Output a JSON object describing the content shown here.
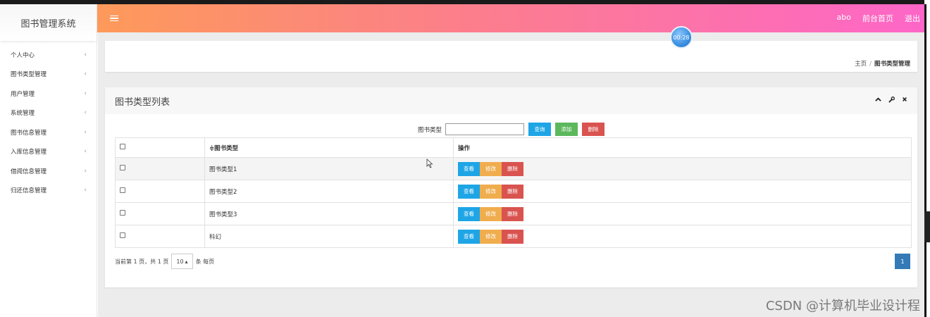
{
  "app": {
    "title": "图书管理系统"
  },
  "sidebar": {
    "items": [
      {
        "label": "个人中心"
      },
      {
        "label": "图书类型管理"
      },
      {
        "label": "用户管理"
      },
      {
        "label": "系统管理"
      },
      {
        "label": "图书信息管理"
      },
      {
        "label": "入库信息管理"
      },
      {
        "label": "借阅信息管理"
      },
      {
        "label": "归还信息管理"
      }
    ],
    "chevron": "‹"
  },
  "header": {
    "user": "abo",
    "front_home": "前台首页",
    "logout": "退出",
    "timer": "00:28"
  },
  "breadcrumb": {
    "home": "主页",
    "separator": "/",
    "current": "图书类型管理"
  },
  "panel": {
    "title": "图书类型列表",
    "tools": {
      "collapse": "⌃",
      "settings": "wrench-icon",
      "close": "✕"
    }
  },
  "search": {
    "label": "图书类型",
    "value": "",
    "query_btn": "查询",
    "add_btn": "添加",
    "delete_btn": "删除"
  },
  "table": {
    "headers": [
      "",
      "≑图书类型",
      "操作"
    ],
    "rows": [
      {
        "type": "图书类型1"
      },
      {
        "type": "图书类型2"
      },
      {
        "type": "图书类型3"
      },
      {
        "type": "科幻"
      }
    ],
    "actions": {
      "view": "查看",
      "edit": "修改",
      "delete": "删除"
    }
  },
  "pagination": {
    "summary": "当前第 1 页，共 1 页",
    "page_size": "10",
    "per_page": "条 每页",
    "current_page": "1"
  },
  "watermark": "CSDN @计算机毕业设计程",
  "colors": {
    "header_gradient_start": "#fd9a5a",
    "header_gradient_end": "#fd66c8",
    "query": "#1ea5e6",
    "add": "#5cb85c",
    "delete": "#d9534f",
    "edit": "#f0ad4e",
    "page_active": "#337ab7"
  }
}
